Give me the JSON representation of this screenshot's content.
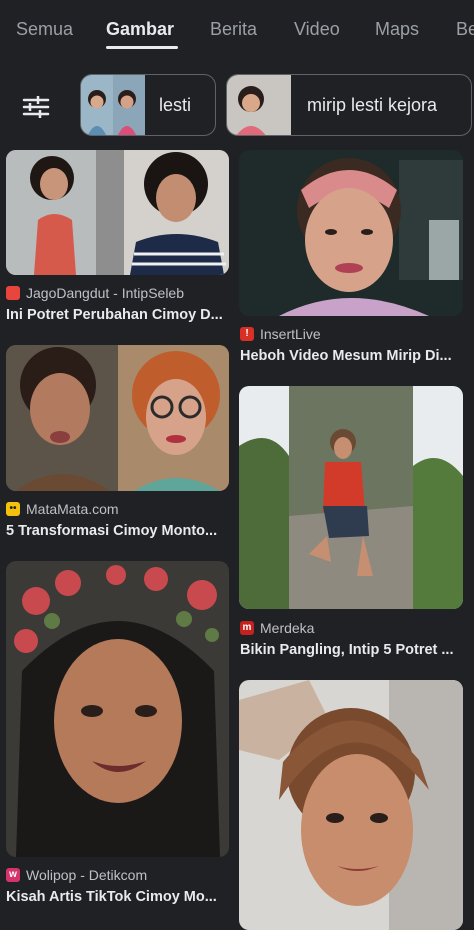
{
  "tabs": [
    "Semua",
    "Gambar",
    "Berita",
    "Video",
    "Maps",
    "Be"
  ],
  "active_tab": "Gambar",
  "chips": [
    {
      "label": "lesti"
    },
    {
      "label": "mirip lesti kejora"
    }
  ],
  "results": [
    {
      "source": "JagoDangdut - IntipSeleb",
      "title": "Ini Potret Perubahan Cimoy D...",
      "favicon_color": "#e8453c"
    },
    {
      "source": "InsertLive",
      "title": "Heboh Video Mesum Mirip Di...",
      "favicon_color": "#d93025"
    },
    {
      "source": "MataMata.com",
      "title": "5 Transformasi Cimoy Monto...",
      "favicon_color": "#f4c20d"
    },
    {
      "source": "Merdeka",
      "title": "Bikin Pangling, Intip 5 Potret ...",
      "favicon_color": "#c5221f"
    },
    {
      "source": "Wolipop - Detikcom",
      "title": "Kisah Artis TikTok Cimoy Mo...",
      "favicon_color": "#d6336c"
    }
  ]
}
